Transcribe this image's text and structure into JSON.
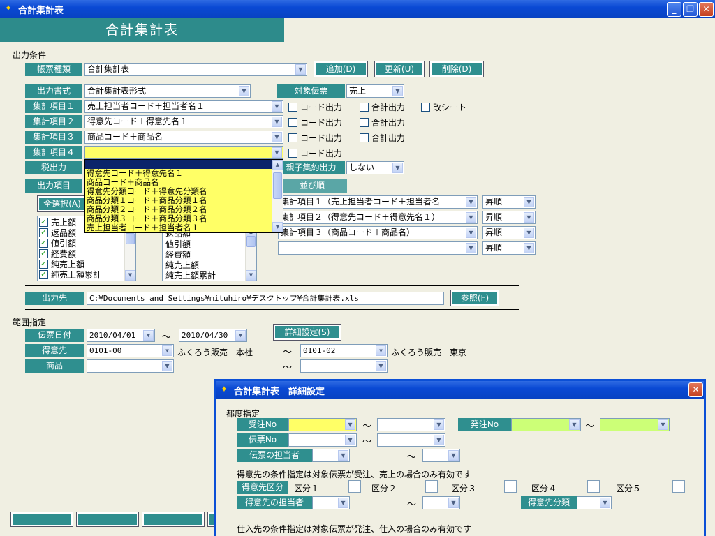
{
  "window": {
    "title": "合計集計表",
    "min": "_",
    "max": "❐",
    "close": "✕"
  },
  "banner": "合計集計表",
  "output_conditions": {
    "section": "出力条件",
    "report_type": {
      "label": "帳票種類",
      "value": "合計集計表"
    },
    "add_button": "追加(D)",
    "update_button": "更新(U)",
    "delete_button": "削除(D)",
    "output_format": {
      "label": "出力書式",
      "value": "合計集計表形式"
    },
    "target_slip": {
      "label": "対象伝票",
      "value": "売上"
    },
    "agg1": {
      "label": "集計項目１",
      "value": "売上担当者コード＋担当者名１"
    },
    "agg2": {
      "label": "集計項目２",
      "value": "得意先コード＋得意先名１"
    },
    "agg3": {
      "label": "集計項目３",
      "value": "商品コード＋商品名"
    },
    "agg4": {
      "label": "集計項目４",
      "value": ""
    },
    "code_output": "コード出力",
    "total_output": "合計出力",
    "new_sheet": "改シート",
    "tax_output": "税出力",
    "parent_child": {
      "label": "親子集約出力",
      "value": "しない"
    },
    "output_items": "出力項目",
    "sort_order": "並び順",
    "select_all": "全選択(A)"
  },
  "dropdown_items": [
    "得意先コード＋得意先名１",
    "商品コード＋商品名",
    "得意先分類コード＋得意先分類名",
    "商品分類１コード＋商品分類１名",
    "商品分類２コード＋商品分類２名",
    "商品分類３コード＋商品分類３名",
    "売上担当者コード＋担当者名１"
  ],
  "left_list": [
    {
      "label": "売上額",
      "checked": true
    },
    {
      "label": "返品額",
      "checked": true
    },
    {
      "label": "値引額",
      "checked": true
    },
    {
      "label": "経費額",
      "checked": true
    },
    {
      "label": "純売上額",
      "checked": true
    },
    {
      "label": "純売上額累計",
      "checked": true
    }
  ],
  "mid_list": [
    "返品額",
    "値引額",
    "経費額",
    "純売上額",
    "純売上額累計"
  ],
  "sort_rows": [
    {
      "item": "集計項目１（売上担当者コード＋担当者名",
      "order": "昇順"
    },
    {
      "item": "集計項目２（得意先コード＋得意先名１）",
      "order": "昇順"
    },
    {
      "item": "集計項目３（商品コード＋商品名）",
      "order": "昇順"
    },
    {
      "item": "",
      "order": "昇順"
    }
  ],
  "output_dest": {
    "label": "出力先",
    "path": "C:¥Documents and Settings¥mituhiro¥デスクトップ¥合計集計表.xls",
    "browse": "参照(F)"
  },
  "range": {
    "section": "範囲指定",
    "slip_date": {
      "label": "伝票日付",
      "from": "2010/04/01",
      "to": "2010/04/30"
    },
    "tilde": "～",
    "detail_button": "詳細設定(S)",
    "customer": {
      "label": "得意先",
      "from": "0101-00",
      "from_name": "ふくろう販売　本社",
      "to": "0101-02",
      "to_name": "ふくろう販売　東京"
    },
    "product": {
      "label": "商品"
    }
  },
  "dialog": {
    "title": "合計集計表　詳細設定",
    "close": "✕",
    "each_spec": "都度指定",
    "order_no": "受注No",
    "purchase_no": "発注No",
    "slip_no": "伝票No",
    "slip_person": "伝票の担当者",
    "customer_note": "得意先の条件指定は対象伝票が受注、売上の場合のみ有効です",
    "customer_class": "得意先区分",
    "class1": "区分１",
    "class2": "区分２",
    "class3": "区分３",
    "class4": "区分４",
    "class5": "区分５",
    "customer_person": "得意先の担当者",
    "customer_category": "得意先分類",
    "supplier_note": "仕入先の条件指定は対象伝票が発注、仕入の場合のみ有効です"
  }
}
